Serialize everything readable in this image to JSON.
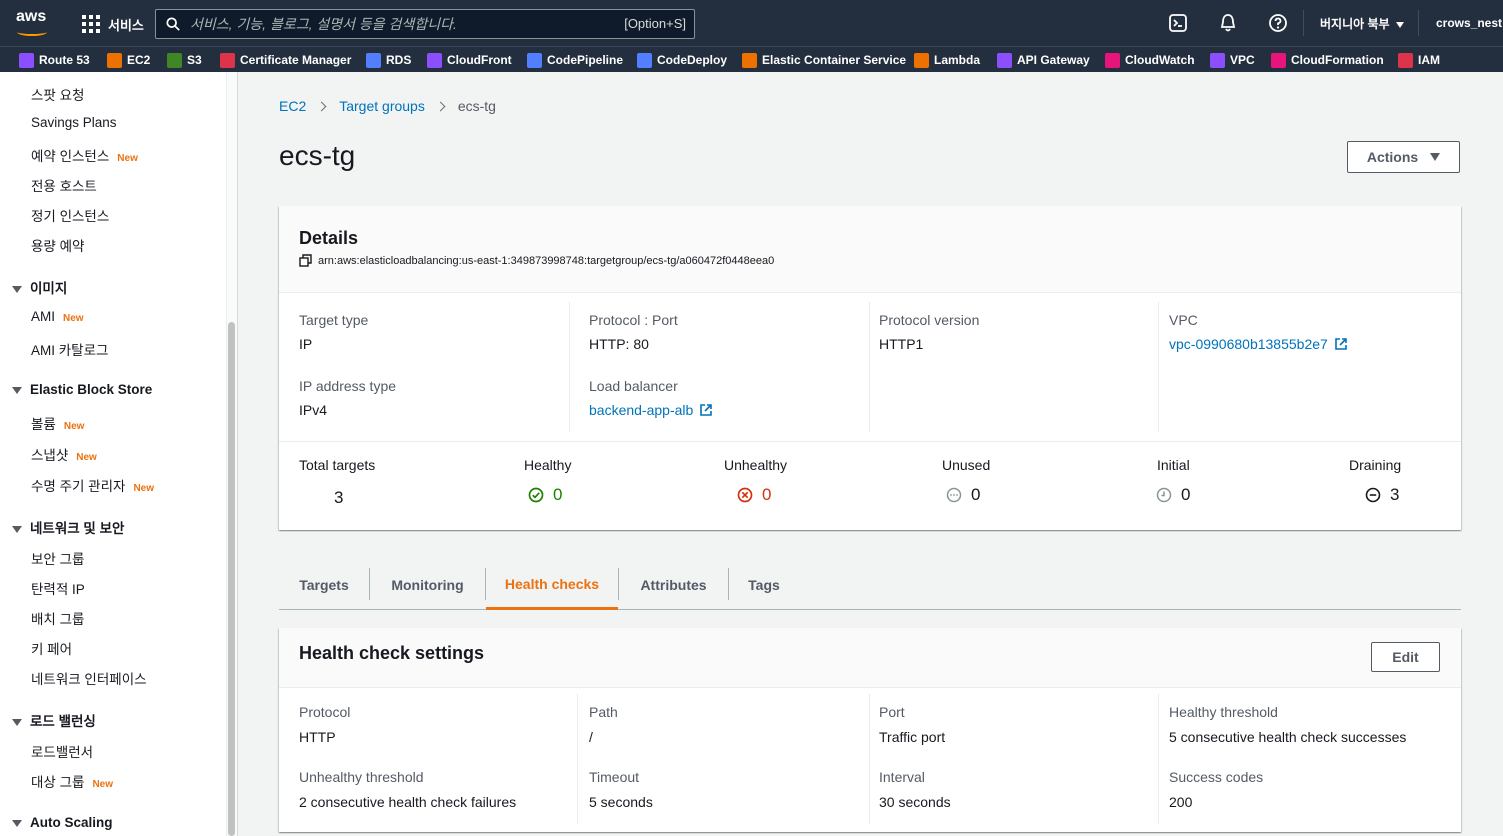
{
  "topnav": {
    "logo": "aws",
    "services": "서비스",
    "search_placeholder": "서비스, 기능, 블로그, 설명서 등을 검색합니다.",
    "search_shortcut": "[Option+S]",
    "region": "버지니아 북부",
    "account": "crows_nest"
  },
  "favorites": [
    {
      "label": "Route 53",
      "color": "#8c4fff"
    },
    {
      "label": "EC2",
      "color": "#ed7100"
    },
    {
      "label": "S3",
      "color": "#3f8624"
    },
    {
      "label": "Certificate Manager",
      "color": "#dd344c"
    },
    {
      "label": "RDS",
      "color": "#527fff"
    },
    {
      "label": "CloudFront",
      "color": "#8c4fff"
    },
    {
      "label": "CodePipeline",
      "color": "#527fff"
    },
    {
      "label": "CodeDeploy",
      "color": "#527fff"
    },
    {
      "label": "Elastic Container Service",
      "color": "#ed7100"
    },
    {
      "label": "Lambda",
      "color": "#ed7100"
    },
    {
      "label": "API Gateway",
      "color": "#8c4fff"
    },
    {
      "label": "CloudWatch",
      "color": "#e7157b"
    },
    {
      "label": "VPC",
      "color": "#8c4fff"
    },
    {
      "label": "CloudFormation",
      "color": "#e7157b"
    },
    {
      "label": "IAM",
      "color": "#dd344c"
    }
  ],
  "sidebar": {
    "new_badge": "New",
    "items": [
      {
        "label": "스팟 요청",
        "new": false
      },
      {
        "label": "Savings Plans",
        "new": false
      },
      {
        "label": "예약 인스턴스",
        "new": true
      },
      {
        "label": "전용 호스트",
        "new": false
      },
      {
        "label": "정기 인스턴스",
        "new": false
      },
      {
        "label": "용량 예약",
        "new": false
      }
    ],
    "group_images": "이미지",
    "images_items": [
      {
        "label": "AMI",
        "new": true
      },
      {
        "label": "AMI 카탈로그",
        "new": false
      }
    ],
    "group_ebs": "Elastic Block Store",
    "ebs_items": [
      {
        "label": "볼륨",
        "new": true
      },
      {
        "label": "스냅샷",
        "new": true
      },
      {
        "label": "수명 주기 관리자",
        "new": true
      }
    ],
    "group_network": "네트워크 및 보안",
    "network_items": [
      {
        "label": "보안 그룹",
        "new": false
      },
      {
        "label": "탄력적 IP",
        "new": false
      },
      {
        "label": "배치 그룹",
        "new": false
      },
      {
        "label": "키 페어",
        "new": false
      },
      {
        "label": "네트워크 인터페이스",
        "new": false
      }
    ],
    "group_lb": "로드 밸런싱",
    "lb_items": [
      {
        "label": "로드밸런서",
        "new": false
      },
      {
        "label": "대상 그룹",
        "new": true
      }
    ],
    "group_autoscaling": "Auto Scaling"
  },
  "breadcrumb": {
    "ec2": "EC2",
    "target_groups": "Target groups",
    "current": "ecs-tg"
  },
  "page": {
    "title": "ecs-tg",
    "actions_label": "Actions"
  },
  "details": {
    "title": "Details",
    "arn": "arn:aws:elasticloadbalancing:us-east-1:349873998748:targetgroup/ecs-tg/a060472f0448eea0",
    "target_type_label": "Target type",
    "target_type": "IP",
    "protocol_port_label": "Protocol : Port",
    "protocol_port": "HTTP: 80",
    "protocol_version_label": "Protocol version",
    "protocol_version": "HTTP1",
    "vpc_label": "VPC",
    "vpc": "vpc-0990680b13855b2e7",
    "ip_type_label": "IP address type",
    "ip_type": "IPv4",
    "lb_label": "Load balancer",
    "lb": "backend-app-alb"
  },
  "counts": {
    "total_label": "Total targets",
    "total": "3",
    "healthy_label": "Healthy",
    "healthy": "0",
    "unhealthy_label": "Unhealthy",
    "unhealthy": "0",
    "unused_label": "Unused",
    "unused": "0",
    "initial_label": "Initial",
    "initial": "0",
    "draining_label": "Draining",
    "draining": "3"
  },
  "tabs": [
    {
      "label": "Targets",
      "active": false
    },
    {
      "label": "Monitoring",
      "active": false
    },
    {
      "label": "Health checks",
      "active": true
    },
    {
      "label": "Attributes",
      "active": false
    },
    {
      "label": "Tags",
      "active": false
    }
  ],
  "health": {
    "title": "Health check settings",
    "edit_label": "Edit",
    "protocol_label": "Protocol",
    "protocol": "HTTP",
    "path_label": "Path",
    "path": "/",
    "port_label": "Port",
    "port": "Traffic port",
    "healthy_threshold_label": "Healthy threshold",
    "healthy_threshold": "5 consecutive health check successes",
    "unhealthy_threshold_label": "Unhealthy threshold",
    "unhealthy_threshold": "2 consecutive health check failures",
    "timeout_label": "Timeout",
    "timeout": "5 seconds",
    "interval_label": "Interval",
    "interval": "30 seconds",
    "success_codes_label": "Success codes",
    "success_codes": "200"
  },
  "colors": {
    "link": "#0073bb",
    "accent": "#ec7211",
    "healthy": "#1d8102",
    "unhealthy": "#d13212",
    "nav_bg": "#232f3e"
  }
}
